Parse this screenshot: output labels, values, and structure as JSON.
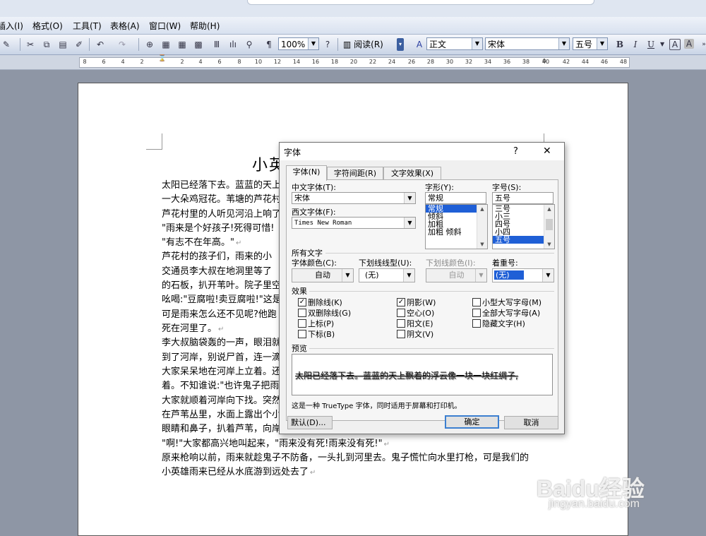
{
  "menubar": {
    "items": [
      "插入(I)",
      "格式(O)",
      "工具(T)",
      "表格(A)",
      "窗口(W)",
      "帮助(H)"
    ]
  },
  "toolbar": {
    "zoom": "100%",
    "reading_label": "阅读(R)",
    "style": "正文",
    "font": "宋体",
    "size": "五号",
    "bold": "B",
    "italic": "I",
    "underline": "U",
    "border_char": "A",
    "shade_char": "A"
  },
  "ruler": {
    "ticks": [
      "8",
      "6",
      "4",
      "2",
      "2",
      "4",
      "6",
      "8",
      "10",
      "12",
      "14",
      "16",
      "18",
      "20",
      "22",
      "24",
      "26",
      "28",
      "30",
      "32",
      "34",
      "36",
      "38",
      "40",
      "42",
      "44",
      "46",
      "48"
    ]
  },
  "document": {
    "title": "小英",
    "lines": [
      "太阳已经落下去。蓝蓝的天上",
      "一大朵鸡冠花。苇塘的芦花村",
      "芦花村里的人听见河沿上响了",
      "\"雨来是个好孩子!死得可惜!",
      "\"有志不在年高。\"",
      "芦花村的孩子们，雨来的小",
      "交通员李大叔在地洞里等了",
      "的石板，扒开苇叶。院子里空",
      "吆喝:\"豆腐啦!卖豆腐啦!\"这是",
      "可是雨来怎么还不见呢?他跑",
      "死在河里了。",
      "李大叔脑袋轰的一声，眼泪就",
      "到了河岸，别说尸首，连一滴",
      "大家呆呆地在河岸上立着。还",
      "着。不知谁说:\"也许鬼子把雨",
      "大家就顺着河岸向下找。突然",
      "在芦苇丛里，水面上露出个小",
      "眼睛和鼻子，扒着芦苇，向岸上",
      "\"啊!\"大家都高兴地叫起来，\"雨来没有死!雨来没有死!\"",
      "原来枪响以前，雨来就趁鬼子不防备，一头扎到河里去。鬼子慌忙向水里打枪，可是我们的",
      "小英雄雨来已经从水底游到远处去了"
    ]
  },
  "dialog": {
    "title": "字体",
    "help": "?",
    "close": "✕",
    "tabs": [
      "字体(N)",
      "字符间距(R)",
      "文字效果(X)"
    ],
    "cn_font_label": "中文字体(T):",
    "cn_font_value": "宋体",
    "west_font_label": "西文字体(F):",
    "west_font_value": "Times New Roman",
    "style_label": "字形(Y):",
    "style_value": "常规",
    "style_list": [
      "常规",
      "倾斜",
      "加粗",
      "加粗 倾斜"
    ],
    "size_label": "字号(S):",
    "size_value": "五号",
    "size_list": [
      "三号",
      "小三",
      "四号",
      "小四",
      "五号"
    ],
    "all_text_label": "所有文字",
    "color_label": "字体颜色(C):",
    "color_value": "自动",
    "underline_label": "下划线线型(U):",
    "underline_value": "(无)",
    "underline_color_label": "下划线颜色(I):",
    "underline_color_value": "自动",
    "emphasis_label": "着重号:",
    "emphasis_value": "(无)",
    "effects_label": "效果",
    "effects": {
      "strike": "删除线(K)",
      "double_strike": "双删除线(G)",
      "superscript": "上标(P)",
      "subscript": "下标(B)",
      "shadow": "阴影(W)",
      "outline": "空心(O)",
      "emboss": "阳文(E)",
      "engrave": "阴文(V)",
      "small_caps": "小型大写字母(M)",
      "all_caps": "全部大写字母(A)",
      "hidden": "隐藏文字(H)"
    },
    "preview_label": "预览",
    "preview_text": "太阳已经落下去。蓝蓝的天上飘着的浮云像一块一块红绸子,",
    "info_text": "这是一种 TrueType 字体，同时适用于屏幕和打印机。",
    "default_btn": "默认(D)...",
    "ok_btn": "确定",
    "cancel_btn": "取消"
  },
  "watermark": {
    "brand": "Baidu经验",
    "url": "jingyan.baidu.com"
  }
}
